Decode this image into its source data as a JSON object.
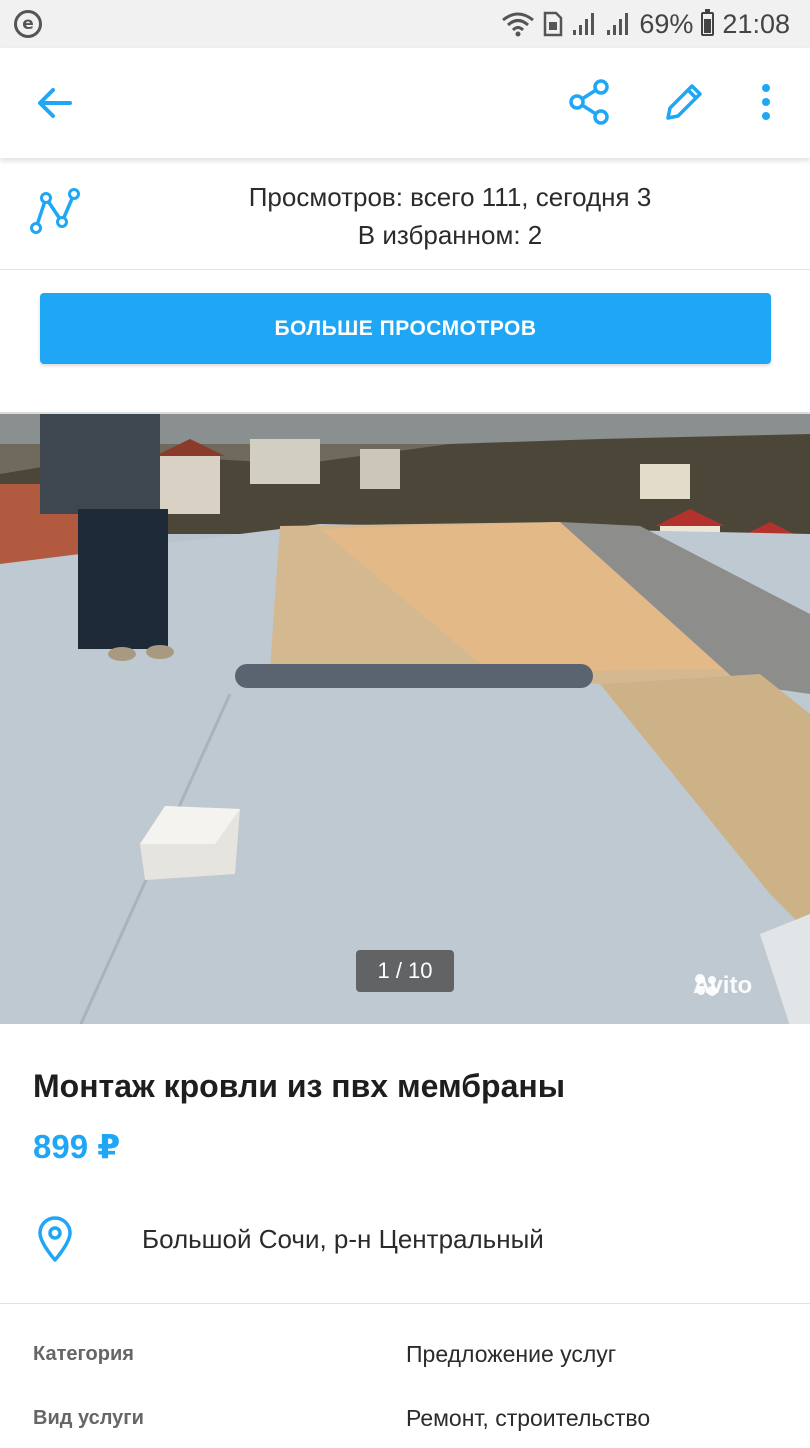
{
  "status_bar": {
    "app_icon": "e-browser-icon",
    "battery": "69%",
    "battery_level": 0.69,
    "time": "21:08"
  },
  "app_bar": {
    "back_icon": "arrow-left-icon",
    "share_icon": "share-icon",
    "edit_icon": "pencil-icon",
    "more_icon": "more-vertical-icon",
    "accent_color": "#1fa7f5"
  },
  "stats": {
    "views_line": "Просмотров: всего 111, сегодня 3",
    "favorites_line": "В избранном: 2"
  },
  "promote_button": {
    "label": "БОЛЬШЕ ПРОСМОТРОВ"
  },
  "gallery": {
    "counter": "1 / 10",
    "watermark": "Avito"
  },
  "listing": {
    "title": "Монтаж кровли из пвх мембраны",
    "price": "899 ₽",
    "location": "Большой Сочи, р-н Центральный"
  },
  "params": [
    {
      "key": "Категория",
      "value": "Предложение услуг"
    },
    {
      "key": "Вид услуги",
      "value": "Ремонт, строительство"
    }
  ]
}
